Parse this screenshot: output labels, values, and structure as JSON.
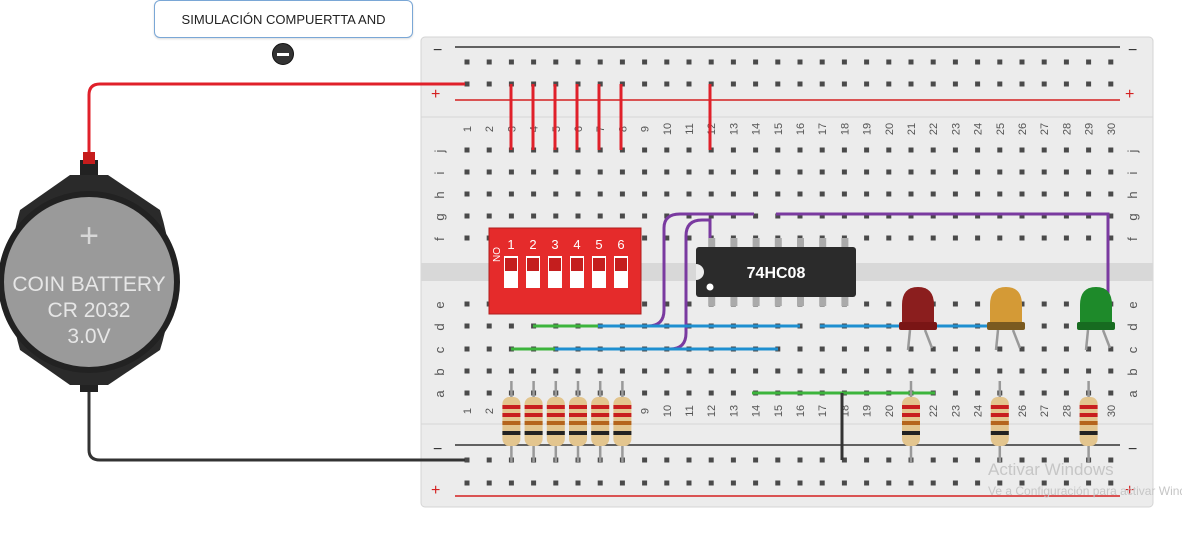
{
  "note": {
    "text": "SIMULACIÓN COMPUERTTA AND"
  },
  "battery": {
    "line1": "COIN BATTERY",
    "line2": "CR 2032",
    "line3": "3.0V",
    "plus": "+"
  },
  "breadboard": {
    "column_numbers": [
      "1",
      "2",
      "3",
      "4",
      "5",
      "6",
      "7",
      "8",
      "9",
      "10",
      "11",
      "12",
      "13",
      "14",
      "15",
      "16",
      "17",
      "18",
      "19",
      "20",
      "21",
      "22",
      "23",
      "24",
      "25",
      "26",
      "27",
      "28",
      "29",
      "30"
    ],
    "row_letters_top": [
      "j",
      "i",
      "h",
      "g",
      "f"
    ],
    "row_letters_bottom": [
      "e",
      "d",
      "c",
      "b",
      "a"
    ],
    "rail_minus": "−",
    "rail_plus": "+"
  },
  "ic": {
    "label": "74HC08"
  },
  "dip_switch": {
    "on_label": "ON",
    "numbers": [
      "1",
      "2",
      "3",
      "4",
      "5",
      "6"
    ]
  },
  "leds": [
    {
      "color_name": "red",
      "color": "#8b1e1e"
    },
    {
      "color_name": "orange",
      "color": "#c98a2a"
    },
    {
      "color_name": "green",
      "color": "#1e8a2a"
    }
  ],
  "watermark": {
    "line1": "Activar Windows",
    "line2": "Ve a Configuración para activar Windows."
  },
  "colors": {
    "board": "#ececec",
    "rail_red": "#d42020",
    "rail_dark": "#333333",
    "wire_red": "#e0202a",
    "wire_purple": "#7a3aa0",
    "wire_blue": "#1e8fd0",
    "wire_green": "#3cb43c",
    "wire_black": "#333333",
    "dip": "#e52b2b",
    "ic": "#2b2b2b"
  },
  "icons": [
    "remove-note-icon"
  ]
}
